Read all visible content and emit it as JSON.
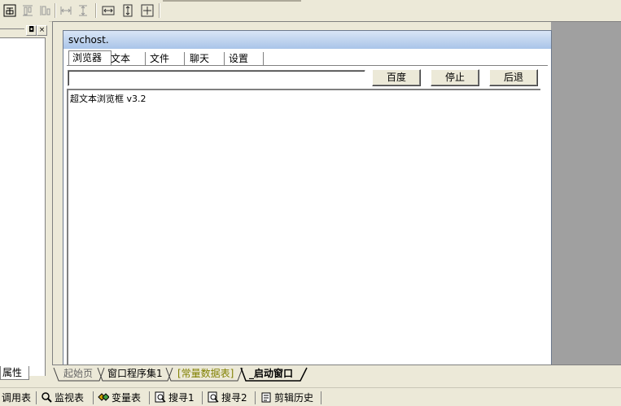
{
  "design_window": {
    "title": "svchost.",
    "tabs": [
      {
        "label": "浏览器",
        "active": true
      },
      {
        "label": "文本",
        "active": false
      },
      {
        "label": "文件",
        "active": false
      },
      {
        "label": "聊天",
        "active": false
      },
      {
        "label": "设置",
        "active": false
      }
    ],
    "url_input": {
      "value": "",
      "placeholder": ""
    },
    "buttons": {
      "baidu": "百度",
      "stop": "停止",
      "back": "后退"
    },
    "browser_text": "超文本浏览框 v3.2"
  },
  "left_panel": {
    "property_tab": "属性"
  },
  "document_tabs": [
    {
      "label": "起始页"
    },
    {
      "label": "窗口程序集1"
    },
    {
      "label": "[常量数据表]"
    },
    {
      "label": "_启动窗口"
    }
  ],
  "bottom_tabs": [
    {
      "label": "调用表",
      "icon": "call-table-icon"
    },
    {
      "label": "监视表",
      "icon": "magnifier-icon"
    },
    {
      "label": "变量表",
      "icon": "variable-icon"
    },
    {
      "label": "搜寻1",
      "icon": "search-doc-icon"
    },
    {
      "label": "搜寻2",
      "icon": "search-doc-icon"
    },
    {
      "label": "剪辑历史",
      "icon": "clipboard-icon"
    }
  ],
  "colors": {
    "accent_title": "#a9c4e8",
    "workspace": "#a0a0a0",
    "constants_tab": "#808000"
  }
}
